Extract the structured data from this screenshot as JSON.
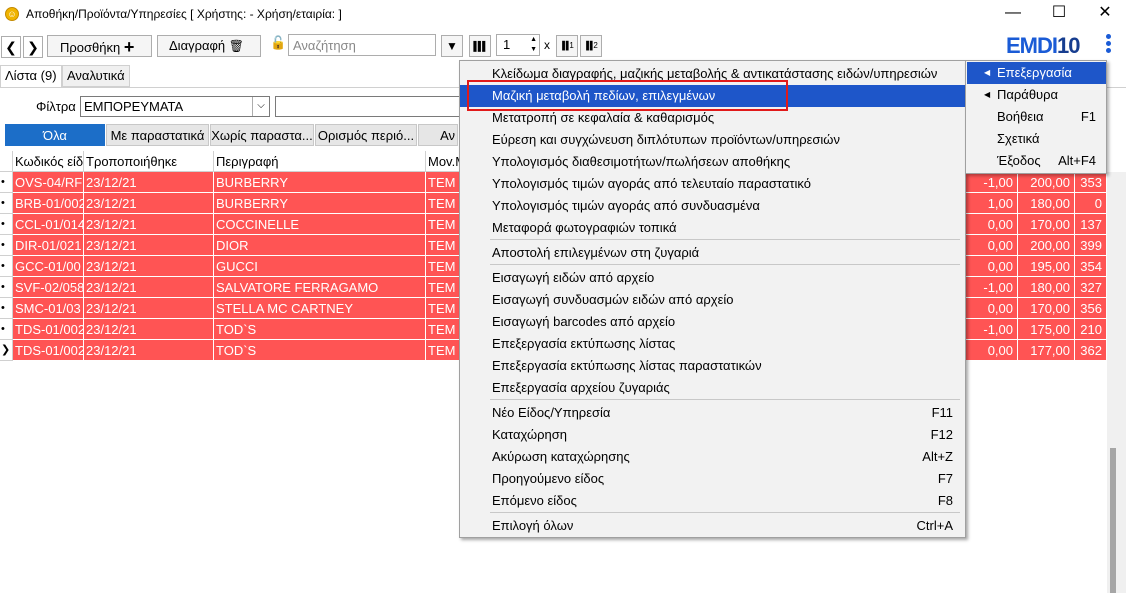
{
  "window": {
    "title": "Αποθήκη/Προϊόντα/Υπηρεσίες  [ Χρήστης:          - Χρήση/εταιρία:                    ]",
    "minimize": "—",
    "maximize": "☐",
    "close": "✕"
  },
  "toolbar": {
    "back": "❮",
    "forward": "❯",
    "add_label": "Προσθήκη",
    "add_icon": "+",
    "delete_label": "Διαγραφή",
    "delete_icon": "🗑",
    "lock_icon": "🔓",
    "search_placeholder": "Αναζήτηση",
    "filter_icon": "▼",
    "barcode_icon": "▌▌▌",
    "copies_value": "1",
    "times": "x",
    "barcode1_icon": "▌▌1",
    "barcode2_icon": "▌▌2"
  },
  "logo": {
    "part1": "EMDI",
    "part2": "10"
  },
  "tabs": [
    {
      "label": "Λίστα (9)"
    },
    {
      "label": "Αναλυτικά"
    }
  ],
  "filter": {
    "label": "Φίλτρα",
    "value": "ΕΜΠΟΡΕΥΜΑΤΑ",
    "arrow": "⌵"
  },
  "filter_buttons": [
    "Όλα",
    "Με παραστατικά",
    "Χωρίς παραστα...",
    "Ορισμός περιό...",
    "Αν"
  ],
  "grid": {
    "columns": [
      "Κωδικός είδ",
      "Τροποποιήθηκε",
      "Περιγραφή",
      "Mov.M"
    ],
    "rows": [
      {
        "ind": "•",
        "code": "OVS-04/RF",
        "date": "23/12/21",
        "desc": "BURBERRY",
        "unit": "TEM",
        "q": "-1,00",
        "price": "200,00",
        "extra": "353"
      },
      {
        "ind": "•",
        "code": "BRB-01/002",
        "date": "23/12/21",
        "desc": "BURBERRY",
        "unit": "TEM",
        "q": "1,00",
        "price": "180,00",
        "extra": "0"
      },
      {
        "ind": "•",
        "code": "CCL-01/014",
        "date": "23/12/21",
        "desc": "COCCINELLE",
        "unit": "TEM",
        "q": "0,00",
        "price": "170,00",
        "extra": "137"
      },
      {
        "ind": "•",
        "code": "DIR-01/021",
        "date": "23/12/21",
        "desc": "DIOR",
        "unit": "TEM",
        "q": "0,00",
        "price": "200,00",
        "extra": "399"
      },
      {
        "ind": "•",
        "code": "GCC-01/00",
        "date": "23/12/21",
        "desc": "GUCCI",
        "unit": "TEM",
        "q": "0,00",
        "price": "195,00",
        "extra": "354"
      },
      {
        "ind": "•",
        "code": "SVF-02/058",
        "date": "23/12/21",
        "desc": "SALVATORE FERRAGAMO",
        "unit": "TEM",
        "q": "-1,00",
        "price": "180,00",
        "extra": "327"
      },
      {
        "ind": "•",
        "code": "SMC-01/03",
        "date": "23/12/21",
        "desc": "STELLA MC CARTNEY",
        "unit": "TEM",
        "q": "0,00",
        "price": "170,00",
        "extra": "356"
      },
      {
        "ind": "•",
        "code": "TDS-01/002",
        "date": "23/12/21",
        "desc": "TOD`S",
        "unit": "TEM",
        "q": "-1,00",
        "price": "175,00",
        "extra": "210"
      },
      {
        "ind": "❯",
        "code": "TDS-01/002",
        "date": "23/12/21",
        "desc": "TOD`S",
        "unit": "TEM",
        "q": "0,00",
        "price": "177,00",
        "extra": "362"
      }
    ]
  },
  "context_menu": {
    "items": [
      {
        "label": "Κλείδωμα διαγραφής, μαζικής μεταβολής & αντικατάστασης ειδών/υπηρεσιών",
        "shortcut": ""
      },
      {
        "label": "Μαζική μεταβολή πεδίων, επιλεγμένων",
        "shortcut": "",
        "highlighted": true
      },
      {
        "label": "Μετατροπή σε κεφαλαία & καθαρισμός",
        "shortcut": ""
      },
      {
        "label": "Εύρεση και συγχώνευση διπλότυπων προϊόντων/υπηρεσιών",
        "shortcut": ""
      },
      {
        "label": "Υπολογισμός διαθεσιμοτήτων/πωλήσεων αποθήκης",
        "shortcut": ""
      },
      {
        "label": "Υπολογισμός τιμών αγοράς από τελευταίο παραστατικό",
        "shortcut": ""
      },
      {
        "label": "Υπολογισμός τιμών αγοράς από συνδυασμένα",
        "shortcut": ""
      },
      {
        "label": "Μεταφορά φωτογραφιών τοπικά",
        "shortcut": ""
      },
      {
        "label": "Αποστολή επιλεγμένων στη ζυγαριά",
        "shortcut": ""
      },
      {
        "label": "Εισαγωγή ειδών από αρχείο",
        "shortcut": ""
      },
      {
        "label": "Εισαγωγή συνδυασμών ειδών από αρχείο",
        "shortcut": ""
      },
      {
        "label": "Εισαγωγή barcodes από αρχείο",
        "shortcut": ""
      },
      {
        "label": "Επεξεργασία εκτύπωσης λίστας",
        "shortcut": ""
      },
      {
        "label": "Επεξεργασία εκτύπωσης λίστας παραστατικών",
        "shortcut": ""
      },
      {
        "label": "Επεξεργασία αρχείου ζυγαριάς",
        "shortcut": ""
      },
      {
        "label": "Νέο Είδος/Υπηρεσία",
        "shortcut": "F11"
      },
      {
        "label": "Καταχώρηση",
        "shortcut": "F12"
      },
      {
        "label": "Ακύρωση καταχώρησης",
        "shortcut": "Alt+Z"
      },
      {
        "label": "Προηγούμενο είδος",
        "shortcut": "F7"
      },
      {
        "label": "Επόμενο είδος",
        "shortcut": "F8"
      },
      {
        "label": "Επιλογή όλων",
        "shortcut": "Ctrl+A"
      }
    ]
  },
  "main_menu": {
    "items": [
      {
        "label": "Επεξεργασία",
        "shortcut": "",
        "submenu": true,
        "highlighted": true
      },
      {
        "label": "Παράθυρα",
        "shortcut": "",
        "submenu": true
      },
      {
        "label": "Βοήθεια",
        "shortcut": "F1"
      },
      {
        "label": "Σχετικά",
        "shortcut": ""
      },
      {
        "label": "Έξοδος",
        "shortcut": "Alt+F4"
      }
    ],
    "submenu_arrow": "◀"
  },
  "colors": {
    "row_highlight": "#ff5454",
    "menu_highlight": "#1e56c9",
    "accent_blue": "#1c6ec8",
    "callout_red": "#e11a1a"
  }
}
